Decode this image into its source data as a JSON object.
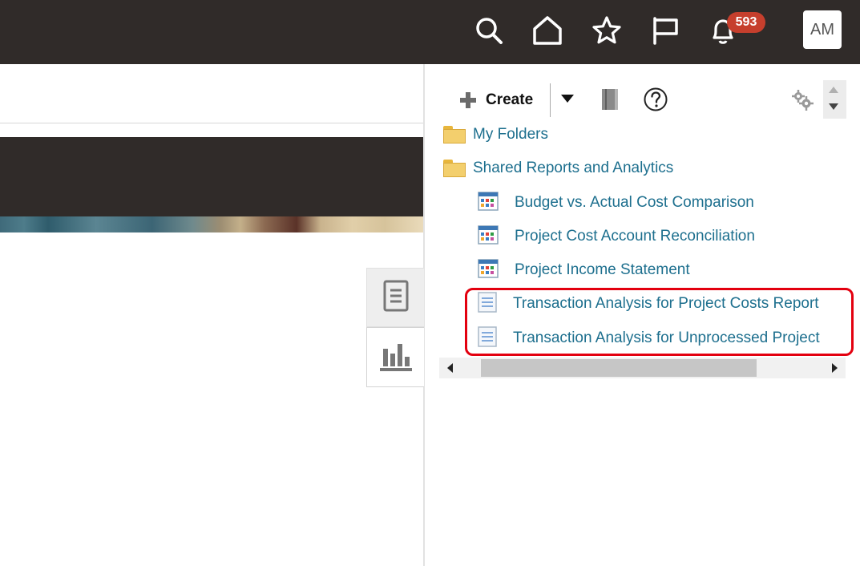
{
  "header": {
    "icons": [
      "search-icon",
      "home-icon",
      "favorites-star-icon",
      "watchlist-flag-icon",
      "notifications-bell-icon"
    ],
    "notification_count": "593",
    "user_initials": "AM",
    "colors": {
      "bar": "#302b29",
      "badge": "#c63f2d",
      "link": "#1d6f8e",
      "highlight": "#e3000f"
    }
  },
  "side_tabs": [
    "document-icon",
    "bar-chart-icon"
  ],
  "toolbar": {
    "create_label": "Create",
    "icons": [
      "add-icon",
      "dropdown-arrow-icon",
      "catalog-book-icon",
      "help-icon",
      "settings-gears-icon"
    ]
  },
  "tree": {
    "folders": [
      {
        "label": "My Folders"
      },
      {
        "label": "Shared Reports and Analytics"
      }
    ],
    "reports": [
      {
        "label": "Budget vs. Actual Cost Comparison",
        "type": "analysis"
      },
      {
        "label": "Project Cost Account Reconciliation",
        "type": "analysis"
      },
      {
        "label": "Project Income Statement",
        "type": "analysis"
      },
      {
        "label": "Transaction Analysis for Project Costs Report",
        "type": "report"
      },
      {
        "label": "Transaction Analysis for Unprocessed Project",
        "type": "report"
      }
    ]
  }
}
